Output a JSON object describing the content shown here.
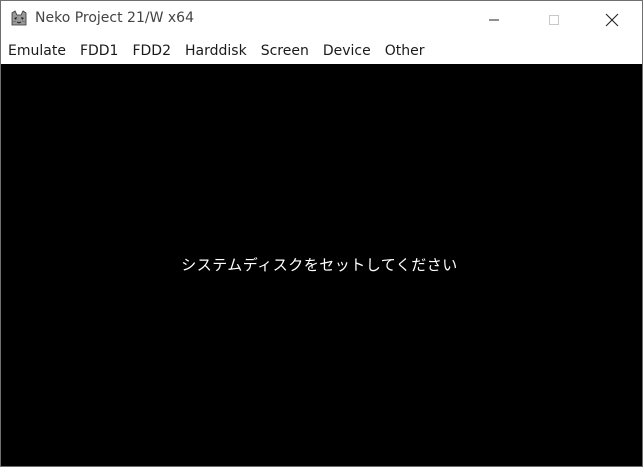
{
  "window": {
    "title": "Neko Project 21/W x64",
    "icon": "neko-cat-icon"
  },
  "caption_buttons": {
    "minimize": "minimize-icon",
    "maximize": "maximize-icon",
    "close": "close-icon"
  },
  "menubar": {
    "items": [
      {
        "label": "Emulate"
      },
      {
        "label": "FDD1"
      },
      {
        "label": "FDD2"
      },
      {
        "label": "Harddisk"
      },
      {
        "label": "Screen"
      },
      {
        "label": "Device"
      },
      {
        "label": "Other"
      }
    ]
  },
  "screen": {
    "message": "システムディスクをセットしてください",
    "background": "#000000",
    "text_color": "#ffffff"
  }
}
